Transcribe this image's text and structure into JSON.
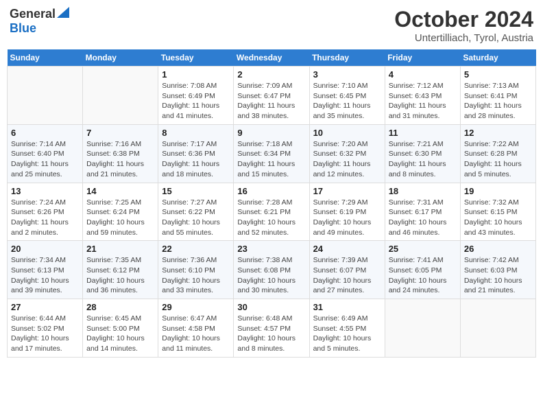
{
  "header": {
    "logo_general": "General",
    "logo_blue": "Blue",
    "title": "October 2024",
    "location": "Untertilliach, Tyrol, Austria"
  },
  "columns": [
    "Sunday",
    "Monday",
    "Tuesday",
    "Wednesday",
    "Thursday",
    "Friday",
    "Saturday"
  ],
  "weeks": [
    [
      {
        "day": "",
        "detail": ""
      },
      {
        "day": "",
        "detail": ""
      },
      {
        "day": "1",
        "detail": "Sunrise: 7:08 AM\nSunset: 6:49 PM\nDaylight: 11 hours and 41 minutes."
      },
      {
        "day": "2",
        "detail": "Sunrise: 7:09 AM\nSunset: 6:47 PM\nDaylight: 11 hours and 38 minutes."
      },
      {
        "day": "3",
        "detail": "Sunrise: 7:10 AM\nSunset: 6:45 PM\nDaylight: 11 hours and 35 minutes."
      },
      {
        "day": "4",
        "detail": "Sunrise: 7:12 AM\nSunset: 6:43 PM\nDaylight: 11 hours and 31 minutes."
      },
      {
        "day": "5",
        "detail": "Sunrise: 7:13 AM\nSunset: 6:41 PM\nDaylight: 11 hours and 28 minutes."
      }
    ],
    [
      {
        "day": "6",
        "detail": "Sunrise: 7:14 AM\nSunset: 6:40 PM\nDaylight: 11 hours and 25 minutes."
      },
      {
        "day": "7",
        "detail": "Sunrise: 7:16 AM\nSunset: 6:38 PM\nDaylight: 11 hours and 21 minutes."
      },
      {
        "day": "8",
        "detail": "Sunrise: 7:17 AM\nSunset: 6:36 PM\nDaylight: 11 hours and 18 minutes."
      },
      {
        "day": "9",
        "detail": "Sunrise: 7:18 AM\nSunset: 6:34 PM\nDaylight: 11 hours and 15 minutes."
      },
      {
        "day": "10",
        "detail": "Sunrise: 7:20 AM\nSunset: 6:32 PM\nDaylight: 11 hours and 12 minutes."
      },
      {
        "day": "11",
        "detail": "Sunrise: 7:21 AM\nSunset: 6:30 PM\nDaylight: 11 hours and 8 minutes."
      },
      {
        "day": "12",
        "detail": "Sunrise: 7:22 AM\nSunset: 6:28 PM\nDaylight: 11 hours and 5 minutes."
      }
    ],
    [
      {
        "day": "13",
        "detail": "Sunrise: 7:24 AM\nSunset: 6:26 PM\nDaylight: 11 hours and 2 minutes."
      },
      {
        "day": "14",
        "detail": "Sunrise: 7:25 AM\nSunset: 6:24 PM\nDaylight: 10 hours and 59 minutes."
      },
      {
        "day": "15",
        "detail": "Sunrise: 7:27 AM\nSunset: 6:22 PM\nDaylight: 10 hours and 55 minutes."
      },
      {
        "day": "16",
        "detail": "Sunrise: 7:28 AM\nSunset: 6:21 PM\nDaylight: 10 hours and 52 minutes."
      },
      {
        "day": "17",
        "detail": "Sunrise: 7:29 AM\nSunset: 6:19 PM\nDaylight: 10 hours and 49 minutes."
      },
      {
        "day": "18",
        "detail": "Sunrise: 7:31 AM\nSunset: 6:17 PM\nDaylight: 10 hours and 46 minutes."
      },
      {
        "day": "19",
        "detail": "Sunrise: 7:32 AM\nSunset: 6:15 PM\nDaylight: 10 hours and 43 minutes."
      }
    ],
    [
      {
        "day": "20",
        "detail": "Sunrise: 7:34 AM\nSunset: 6:13 PM\nDaylight: 10 hours and 39 minutes."
      },
      {
        "day": "21",
        "detail": "Sunrise: 7:35 AM\nSunset: 6:12 PM\nDaylight: 10 hours and 36 minutes."
      },
      {
        "day": "22",
        "detail": "Sunrise: 7:36 AM\nSunset: 6:10 PM\nDaylight: 10 hours and 33 minutes."
      },
      {
        "day": "23",
        "detail": "Sunrise: 7:38 AM\nSunset: 6:08 PM\nDaylight: 10 hours and 30 minutes."
      },
      {
        "day": "24",
        "detail": "Sunrise: 7:39 AM\nSunset: 6:07 PM\nDaylight: 10 hours and 27 minutes."
      },
      {
        "day": "25",
        "detail": "Sunrise: 7:41 AM\nSunset: 6:05 PM\nDaylight: 10 hours and 24 minutes."
      },
      {
        "day": "26",
        "detail": "Sunrise: 7:42 AM\nSunset: 6:03 PM\nDaylight: 10 hours and 21 minutes."
      }
    ],
    [
      {
        "day": "27",
        "detail": "Sunrise: 6:44 AM\nSunset: 5:02 PM\nDaylight: 10 hours and 17 minutes."
      },
      {
        "day": "28",
        "detail": "Sunrise: 6:45 AM\nSunset: 5:00 PM\nDaylight: 10 hours and 14 minutes."
      },
      {
        "day": "29",
        "detail": "Sunrise: 6:47 AM\nSunset: 4:58 PM\nDaylight: 10 hours and 11 minutes."
      },
      {
        "day": "30",
        "detail": "Sunrise: 6:48 AM\nSunset: 4:57 PM\nDaylight: 10 hours and 8 minutes."
      },
      {
        "day": "31",
        "detail": "Sunrise: 6:49 AM\nSunset: 4:55 PM\nDaylight: 10 hours and 5 minutes."
      },
      {
        "day": "",
        "detail": ""
      },
      {
        "day": "",
        "detail": ""
      }
    ]
  ]
}
